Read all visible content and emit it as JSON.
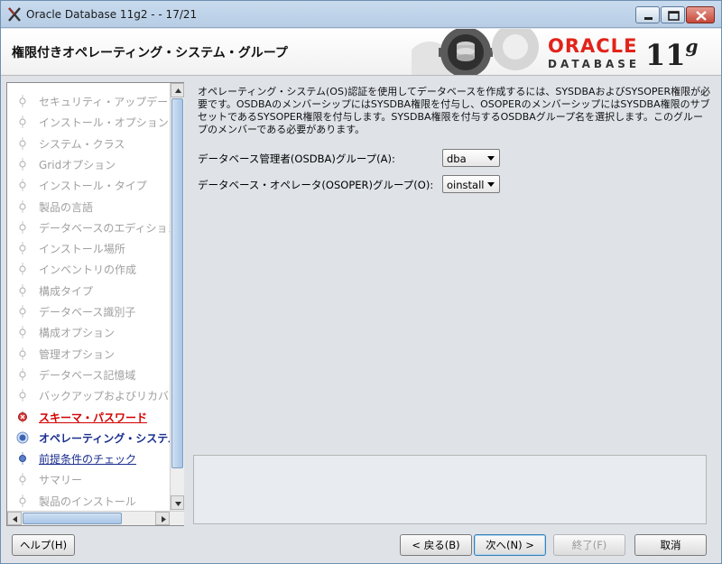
{
  "window": {
    "title": "Oracle Database 11g2 -  - 17/21"
  },
  "banner": {
    "page_title": "権限付きオペレーティング・システム・グループ",
    "brand": "ORACLE",
    "product": "DATABASE",
    "version": "11",
    "version_sup": "g"
  },
  "nav": {
    "items": [
      {
        "label": "セキュリティ・アップデート",
        "state": "done"
      },
      {
        "label": "インストール・オプション",
        "state": "done"
      },
      {
        "label": "システム・クラス",
        "state": "done"
      },
      {
        "label": "Gridオプション",
        "state": "done"
      },
      {
        "label": "インストール・タイプ",
        "state": "done"
      },
      {
        "label": "製品の言語",
        "state": "done"
      },
      {
        "label": "データベースのエディション",
        "state": "done"
      },
      {
        "label": "インストール場所",
        "state": "done"
      },
      {
        "label": "インベントリの作成",
        "state": "done"
      },
      {
        "label": "構成タイプ",
        "state": "done"
      },
      {
        "label": "データベース識別子",
        "state": "done"
      },
      {
        "label": "構成オプション",
        "state": "done"
      },
      {
        "label": "管理オプション",
        "state": "done"
      },
      {
        "label": "データベース記憶域",
        "state": "done"
      },
      {
        "label": "バックアップおよびリカバリ",
        "state": "done"
      },
      {
        "label": "スキーマ・パスワード",
        "state": "error"
      },
      {
        "label": "オペレーティング・システム・グループ",
        "state": "current"
      },
      {
        "label": "前提条件のチェック",
        "state": "link"
      },
      {
        "label": "サマリー",
        "state": "pending"
      },
      {
        "label": "製品のインストール",
        "state": "pending"
      }
    ]
  },
  "main": {
    "description": "オペレーティング・システム(OS)認証を使用してデータベースを作成するには、SYSDBAおよびSYSOPER権限が必要です。OSDBAのメンバーシップにはSYSDBA権限を付与し、OSOPERのメンバーシップにはSYSDBA権限のサブセットであるSYSOPER権限を付与します。SYSDBA権限を付与するOSDBAグループ名を選択します。このグループのメンバーである必要があります。",
    "osdba_label": "データベース管理者(OSDBA)グループ(A):",
    "osdba_value": "dba",
    "osoper_label": "データベース・オペレータ(OSOPER)グループ(O):",
    "osoper_value": "oinstall"
  },
  "buttons": {
    "help": "ヘルプ(H)",
    "back": "< 戻る(B)",
    "next": "次へ(N) >",
    "finish": "終了(F)",
    "cancel": "取消"
  },
  "colors": {
    "error": "#d20000",
    "link": "#1a2e8f",
    "brand": "#e2231a"
  }
}
